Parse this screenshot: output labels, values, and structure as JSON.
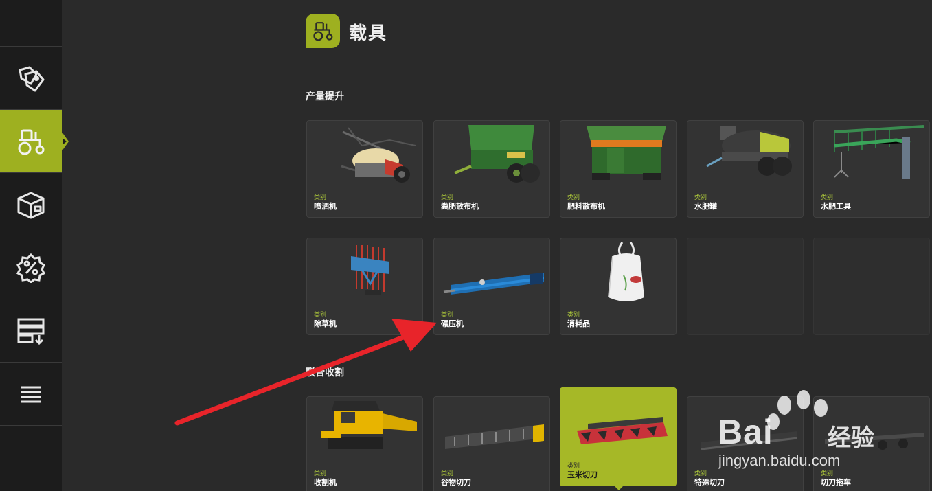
{
  "header": {
    "title": "载具",
    "icon": "tractor-icon"
  },
  "sidebar": {
    "items": [
      {
        "name": "sidebar-item-sales",
        "icon": "price-tags-icon",
        "active": false
      },
      {
        "name": "sidebar-item-vehicles",
        "icon": "tractor-icon",
        "active": true
      },
      {
        "name": "sidebar-item-objects",
        "icon": "box-icon",
        "active": false
      },
      {
        "name": "sidebar-item-discounts",
        "icon": "percent-badge-icon",
        "active": false
      },
      {
        "name": "sidebar-item-storage",
        "icon": "list-download-icon",
        "active": false
      },
      {
        "name": "sidebar-item-menu",
        "icon": "hamburger-icon",
        "active": false
      }
    ]
  },
  "sections": [
    {
      "title": "产量提升",
      "rows": [
        [
          {
            "category": "类别",
            "name": "喷洒机",
            "icon": "sprayer-icon"
          },
          {
            "category": "类别",
            "name": "粪肥散布机",
            "icon": "manure-spreader-icon"
          },
          {
            "category": "类别",
            "name": "肥料散布机",
            "icon": "fertilizer-spreader-icon"
          },
          {
            "category": "类别",
            "name": "水肥罐",
            "icon": "slurry-tank-icon"
          },
          {
            "category": "类别",
            "name": "水肥工具",
            "icon": "slurry-tool-icon"
          }
        ],
        [
          {
            "category": "类别",
            "name": "除草机",
            "icon": "weeder-icon"
          },
          {
            "category": "类别",
            "name": "碾压机",
            "icon": "roller-icon"
          },
          {
            "category": "类别",
            "name": "消耗品",
            "icon": "bigbag-icon"
          }
        ]
      ]
    },
    {
      "title": "联合收割",
      "rows": [
        [
          {
            "category": "类别",
            "name": "收割机",
            "icon": "combine-harvester-icon"
          },
          {
            "category": "类别",
            "name": "谷物切刀",
            "icon": "grain-header-icon"
          },
          {
            "category": "类别",
            "name": "玉米切刀",
            "icon": "corn-header-icon",
            "selected": true
          },
          {
            "category": "类别",
            "name": "特殊切刀",
            "icon": "special-header-icon"
          },
          {
            "category": "类别",
            "name": "切刀拖车",
            "icon": "header-trailer-icon"
          }
        ]
      ]
    }
  ],
  "watermark": {
    "brand": "Bai",
    "brand_cn": "经验",
    "url": "jingyan.baidu.com"
  },
  "colors": {
    "accent": "#9eb020",
    "annotation_arrow": "#e8242a"
  }
}
